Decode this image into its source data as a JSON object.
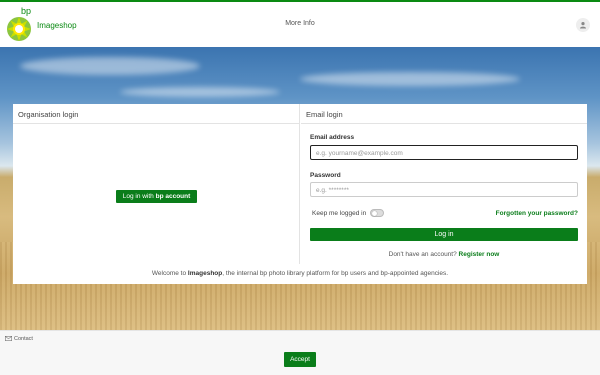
{
  "header": {
    "logo_text": "bp",
    "brand": "Imageshop",
    "more_info": "More Info"
  },
  "organisation": {
    "title": "Organisation login",
    "button_prefix": "Log in with ",
    "button_bold": "bp account"
  },
  "email_login": {
    "title": "Email login",
    "email_label": "Email address",
    "email_placeholder": "e.g. yourname@example.com",
    "password_label": "Password",
    "password_placeholder": "e.g. ********",
    "keep_logged_in": "Keep me logged in",
    "forgot": "Forgotten your password?",
    "login_button": "Log in",
    "no_account": "Don't have an account?",
    "register": "Register now"
  },
  "welcome": {
    "prefix": "Welcome to ",
    "brand": "Imageshop",
    "suffix": ", the internal bp photo library platform for bp users and bp-appointed agencies."
  },
  "footer": {
    "contact": "Contact",
    "accept": "Accept"
  },
  "colors": {
    "brand_green": "#0a7d1a"
  }
}
